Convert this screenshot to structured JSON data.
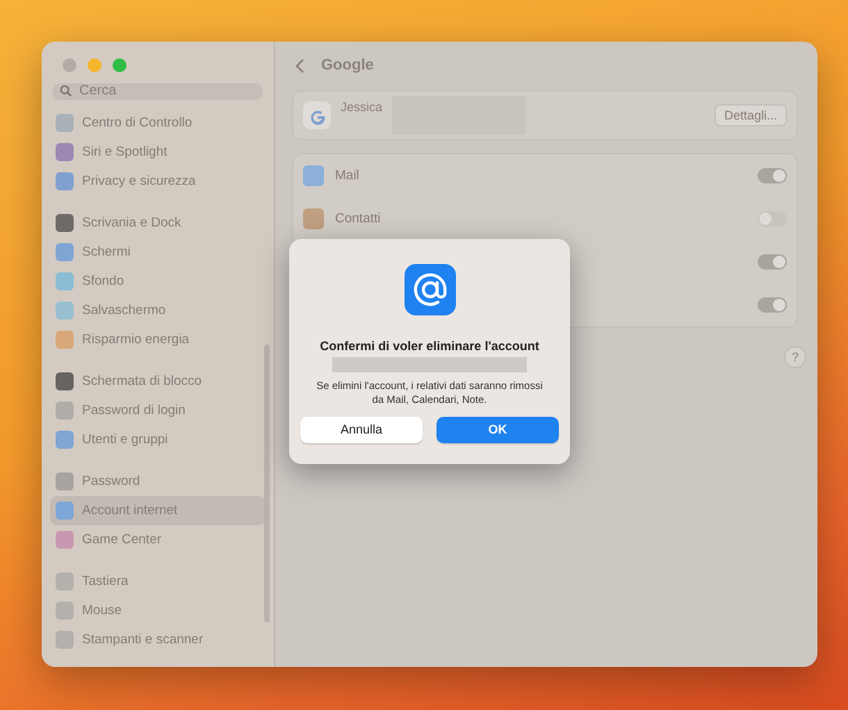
{
  "sidebar": {
    "search": {
      "placeholder": "Cerca"
    },
    "groups": [
      [
        {
          "label": "Centro di Controllo",
          "color": "#aab0b8",
          "selected": false
        },
        {
          "label": "Siri e Spotlight",
          "color": "#9c88b4",
          "selected": false
        },
        {
          "label": "Privacy e sicurezza",
          "color": "#80a0d0",
          "selected": false
        }
      ],
      [
        {
          "label": "Scrivania e Dock",
          "color": "#6e6a68",
          "selected": false
        },
        {
          "label": "Schermi",
          "color": "#80a4d4",
          "selected": false
        },
        {
          "label": "Sfondo",
          "color": "#8cbcd4",
          "selected": false
        },
        {
          "label": "Salvaschermo",
          "color": "#98c0d0",
          "selected": false
        },
        {
          "label": "Risparmio energia",
          "color": "#d8a878",
          "selected": false
        }
      ],
      [
        {
          "label": "Schermata di blocco",
          "color": "#686462",
          "selected": false
        },
        {
          "label": "Password di login",
          "color": "#b0aca8",
          "selected": false
        },
        {
          "label": "Utenti e gruppi",
          "color": "#80a4d4",
          "selected": false
        }
      ],
      [
        {
          "label": "Password",
          "color": "#a8a4a0",
          "selected": false
        },
        {
          "label": "Account internet",
          "color": "#7ea6d8",
          "selected": true
        },
        {
          "label": "Game Center",
          "color": "#c898b0",
          "selected": false
        }
      ],
      [
        {
          "label": "Tastiera",
          "color": "#b4b0ac",
          "selected": false
        },
        {
          "label": "Mouse",
          "color": "#b4b0ac",
          "selected": false
        },
        {
          "label": "Stampanti e scanner",
          "color": "#b4b0ac",
          "selected": false
        }
      ]
    ]
  },
  "content": {
    "title": "Google",
    "account": {
      "name": "Jessica",
      "button": "Dettagli..."
    },
    "services": [
      {
        "label": "Mail",
        "color": "#8cb0d8",
        "on": true
      },
      {
        "label": "Contatti",
        "color": "#c0a080",
        "on": false
      },
      {
        "on": true
      },
      {
        "on": true
      }
    ],
    "help": "?"
  },
  "dialog": {
    "title": "Confermi di voler eliminare l'account",
    "message": "Se elimini l'account, i relativi dati saranno rimossi da Mail, Calendari, Note.",
    "buttons": [
      {
        "label": "Annulla",
        "kind": "cancel"
      },
      {
        "label": "OK",
        "kind": "default"
      }
    ]
  }
}
